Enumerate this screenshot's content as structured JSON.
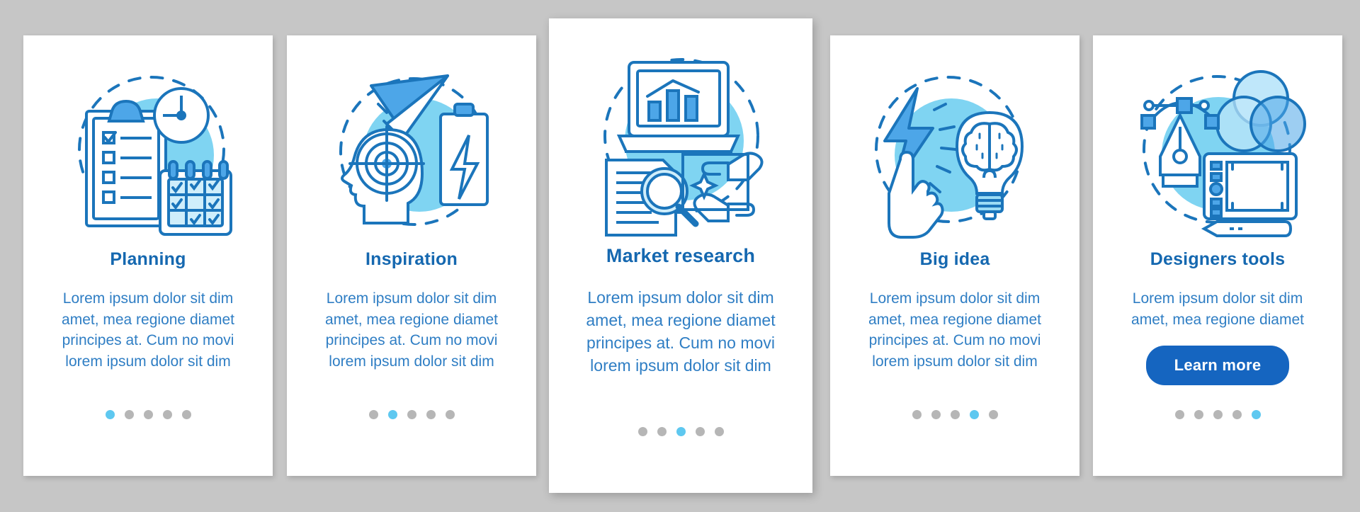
{
  "page": {
    "background_color": "#c6c6c6",
    "card_background": "#ffffff"
  },
  "theme": {
    "title_color": "#1568b0",
    "body_color": "#2f7ec4",
    "accent_blue": "#1565c0",
    "line_blue": "#1b75bb",
    "fill_light_blue": "#7fd4f2",
    "fill_mid_blue": "#4da6e8",
    "dot_inactive": "#b6b6b6",
    "dot_active": "#5ec8f0"
  },
  "cards": [
    {
      "id": "card-1",
      "variant": "side",
      "illustration": "planning-illustration",
      "illustration_parts": [
        "clipboard-checklist-icon",
        "clock-icon",
        "calendar-icon",
        "dashed-circle-icon",
        "blue-blob-icon"
      ],
      "title": "Planning",
      "body": "Lorem ipsum dolor sit dim amet, mea regione diamet principes at. Cum no movi lorem ipsum dolor sit dim",
      "has_button": false,
      "button_label": "",
      "dots": {
        "count": 5,
        "active_index": 0
      }
    },
    {
      "id": "card-2",
      "variant": "side",
      "illustration": "inspiration-illustration",
      "illustration_parts": [
        "paper-plane-icon",
        "head-target-icon",
        "battery-bolt-icon",
        "dashed-circle-icon",
        "blue-blob-icon"
      ],
      "title": "Inspiration",
      "body": "Lorem ipsum dolor sit dim amet, mea regione diamet principes at. Cum no movi lorem ipsum dolor sit dim",
      "has_button": false,
      "button_label": "",
      "dots": {
        "count": 5,
        "active_index": 1
      }
    },
    {
      "id": "card-3",
      "variant": "center",
      "illustration": "market-research-illustration",
      "illustration_parts": [
        "laptop-chart-icon",
        "document-magnifier-icon",
        "pointing-hands-icon",
        "dashed-circle-icon",
        "blue-blob-icon"
      ],
      "title": "Market research",
      "body": "Lorem ipsum dolor sit dim amet, mea regione diamet principes at. Cum no movi lorem ipsum dolor sit dim",
      "has_button": false,
      "button_label": "",
      "dots": {
        "count": 5,
        "active_index": 2
      }
    },
    {
      "id": "card-4",
      "variant": "side",
      "illustration": "big-idea-illustration",
      "illustration_parts": [
        "lightning-bolt-icon",
        "pointing-hand-icon",
        "lightbulb-brain-icon",
        "dashed-circle-icon",
        "blue-blob-icon"
      ],
      "title": "Big idea",
      "body": "Lorem ipsum dolor sit dim amet, mea regione diamet principes at. Cum no movi lorem ipsum dolor sit dim",
      "has_button": false,
      "button_label": "",
      "dots": {
        "count": 5,
        "active_index": 3
      }
    },
    {
      "id": "card-5",
      "variant": "side",
      "illustration": "designers-tools-illustration",
      "illustration_parts": [
        "pen-tool-icon",
        "venn-circles-icon",
        "drawing-tablet-icon",
        "stylus-icon",
        "dashed-circle-icon",
        "blue-blob-icon"
      ],
      "title": "Designers tools",
      "body": "Lorem ipsum dolor sit dim amet, mea regione diamet",
      "has_button": true,
      "button_label": "Learn more",
      "dots": {
        "count": 5,
        "active_index": 4
      }
    }
  ]
}
